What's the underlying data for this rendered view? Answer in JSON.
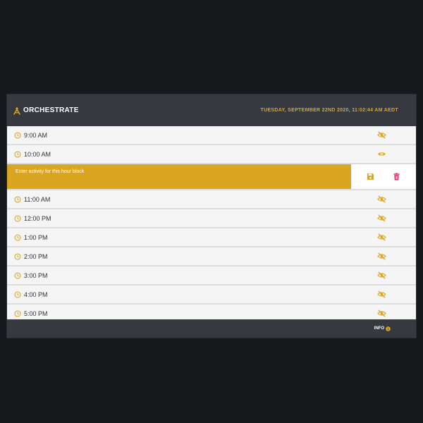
{
  "header": {
    "brand": "ORCHESTRATE",
    "datetime": "TUESDAY, SEPTEMBER 22ND 2020, 11:02:44 AM AEDT"
  },
  "colors": {
    "accent": "#daa520",
    "header_bg": "#363a40",
    "delete": "#e0245e",
    "page_bg": "#16191c"
  },
  "hours": [
    {
      "label": "9:00 AM",
      "icon": "eye-slash-icon"
    },
    {
      "label": "10:00 AM",
      "icon": "eye-icon"
    },
    {
      "label": "11:00 AM",
      "icon": "eye-slash-icon"
    },
    {
      "label": "12:00 PM",
      "icon": "eye-slash-icon"
    },
    {
      "label": "1:00 PM",
      "icon": "eye-slash-icon"
    },
    {
      "label": "2:00 PM",
      "icon": "eye-slash-icon"
    },
    {
      "label": "3:00 PM",
      "icon": "eye-slash-icon"
    },
    {
      "label": "4:00 PM",
      "icon": "eye-slash-icon"
    },
    {
      "label": "5:00 PM",
      "icon": "eye-slash-icon"
    }
  ],
  "editor": {
    "placeholder": "Enter activity for this hour block",
    "save_icon": "save-icon",
    "delete_icon": "trash-icon"
  },
  "footer": {
    "info_label": "INFO",
    "info_icon": "info-circle-icon"
  }
}
